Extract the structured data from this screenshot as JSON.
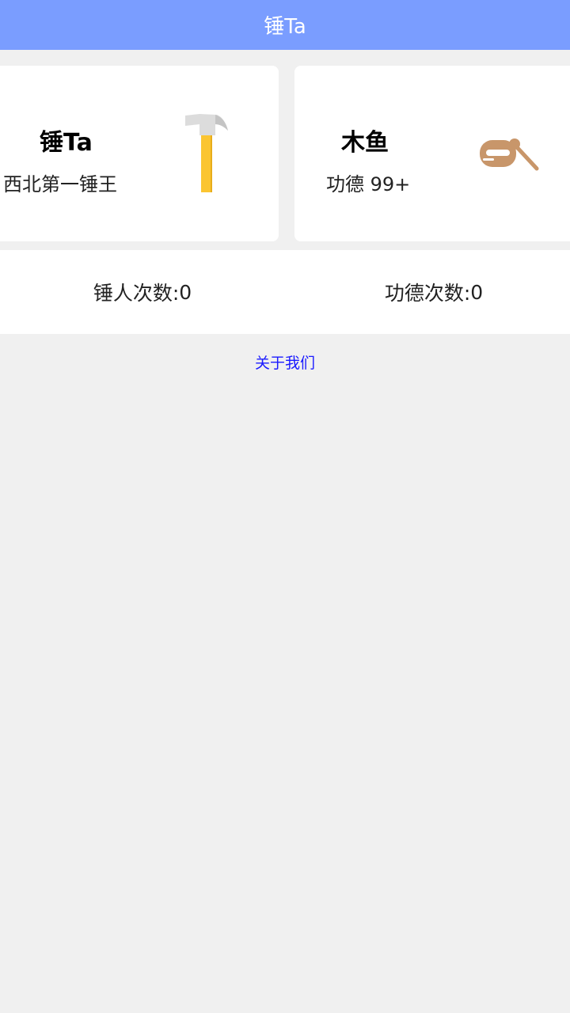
{
  "header": {
    "title": "锤Ta"
  },
  "cards": [
    {
      "title": "锤Ta",
      "subtitle": "西北第一锤王",
      "icon": "hammer-icon",
      "icon_color": "#fbc531"
    },
    {
      "title": "木鱼",
      "subtitle": "功德 99+",
      "icon": "wooden-fish-icon",
      "icon_color": "#c8966a"
    }
  ],
  "stats": {
    "hammer_label": "锤人次数:",
    "hammer_count": "0",
    "merit_label": "功德次数:",
    "merit_count": "0"
  },
  "footer": {
    "about_link": "关于我们"
  },
  "colors": {
    "header_bg": "#7a9dff",
    "page_bg": "#f0f0f0",
    "link": "#1a1aff"
  }
}
